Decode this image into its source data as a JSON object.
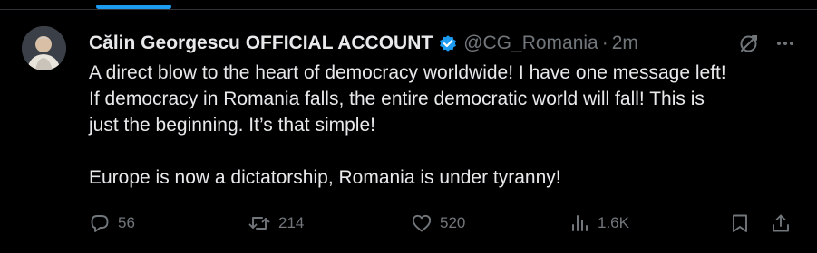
{
  "header": {
    "display_name": "Călin Georgescu OFFICIAL ACCOUNT",
    "handle": "@CG_Romania",
    "separator": "·",
    "time": "2m"
  },
  "tweet": {
    "lines": [
      "A direct blow to the heart of democracy worldwide! I have one message left!",
      "If democracy in Romania falls, the entire democratic world will fall! This is",
      "just the beginning. It’s that simple!"
    ],
    "second_paragraph": "Europe is now a dictatorship, Romania is under tyranny!"
  },
  "actions": {
    "replies": "56",
    "reposts": "214",
    "likes": "520",
    "views": "1.6K"
  },
  "icons": {
    "verified": "verified-badge-icon",
    "grok": "grok-icon",
    "more": "more-icon",
    "reply": "reply-icon",
    "repost": "repost-icon",
    "like": "heart-icon",
    "views": "views-icon",
    "bookmark": "bookmark-icon",
    "share": "share-icon"
  },
  "colors": {
    "background": "#000000",
    "text": "#e7e9ea",
    "secondary": "#71767b",
    "accent": "#1d9bf0",
    "divider": "#2f3336"
  }
}
